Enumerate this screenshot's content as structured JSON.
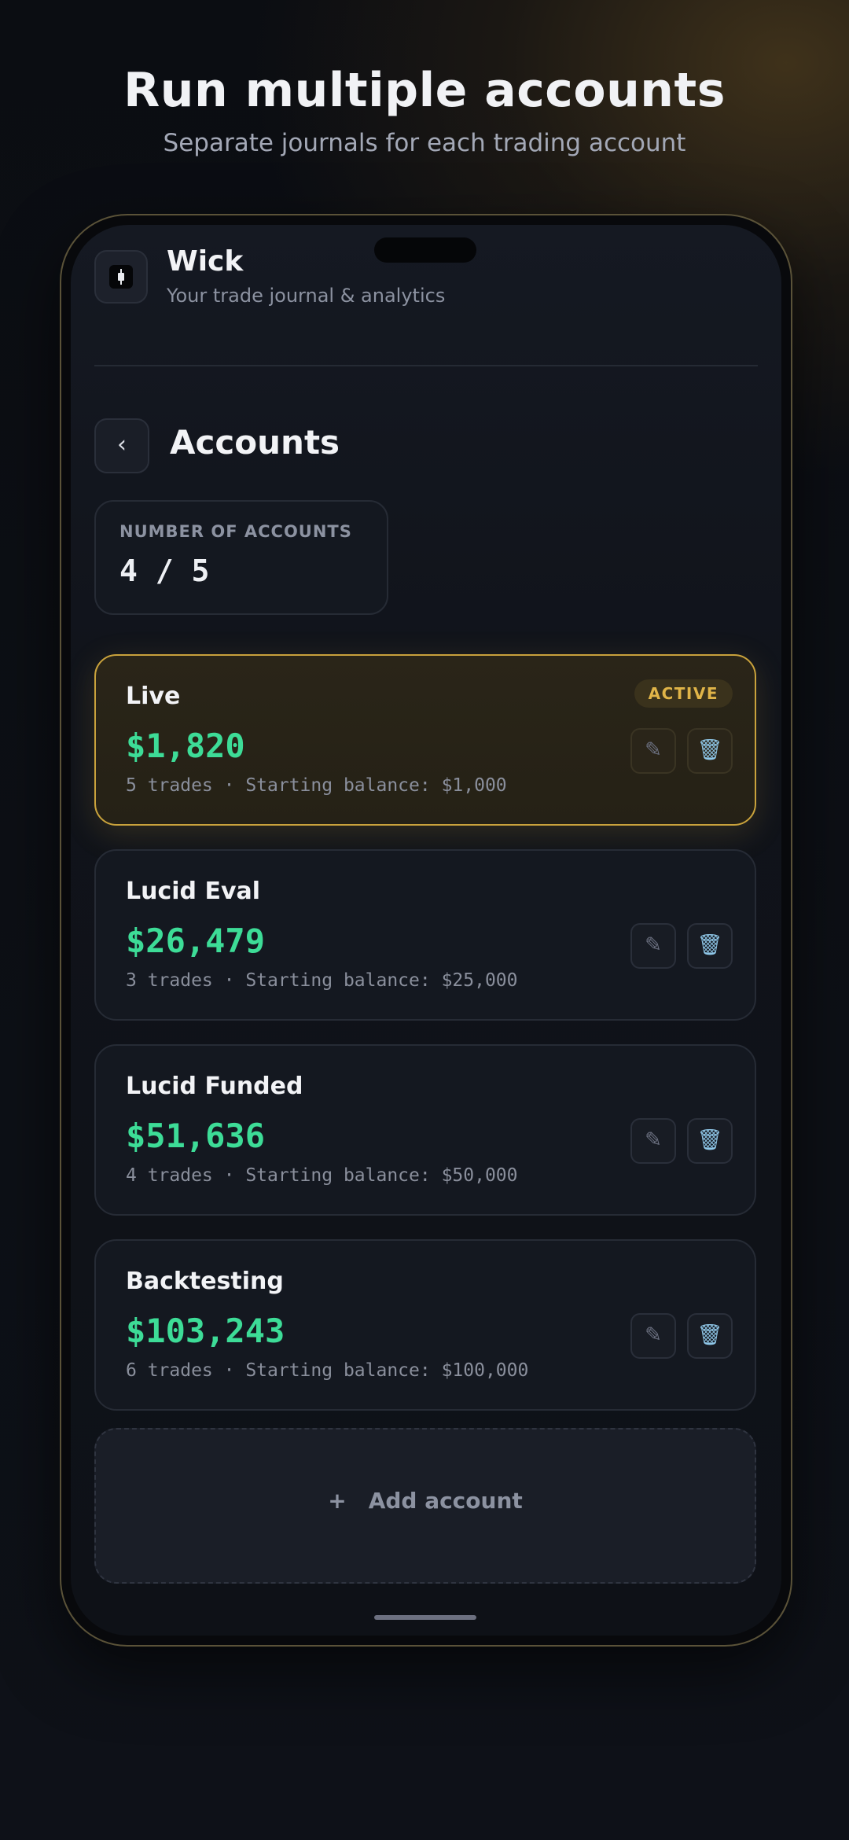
{
  "promo": {
    "headline": "Run multiple accounts",
    "subheadline": "Separate journals for each trading account"
  },
  "app": {
    "title": "Wick",
    "tagline": "Your trade journal & analytics",
    "logo_icon": "candlestick-icon"
  },
  "page": {
    "back_glyph": "‹",
    "title": "Accounts"
  },
  "account_count": {
    "label": "NUMBER OF ACCOUNTS",
    "value": "4 / 5"
  },
  "accounts": [
    {
      "name": "Live",
      "balance": "$1,820",
      "meta": "5 trades · Starting balance: $1,000",
      "badge": "ACTIVE",
      "active": true
    },
    {
      "name": "Lucid Eval",
      "balance": "$26,479",
      "meta": "3 trades · Starting balance: $25,000",
      "active": false
    },
    {
      "name": "Lucid Funded",
      "balance": "$51,636",
      "meta": "4 trades · Starting balance: $50,000",
      "active": false
    },
    {
      "name": "Backtesting",
      "balance": "$103,243",
      "meta": "6 trades · Starting balance: $100,000",
      "active": false
    }
  ],
  "actions": {
    "edit_glyph": "✎",
    "delete_glyph": "🗑"
  },
  "add_account": {
    "plus_glyph": "+",
    "label": "Add account"
  },
  "colors": {
    "accent_gold": "#c9a23c",
    "balance_green": "#3ddc97",
    "background": "#0d1016"
  }
}
